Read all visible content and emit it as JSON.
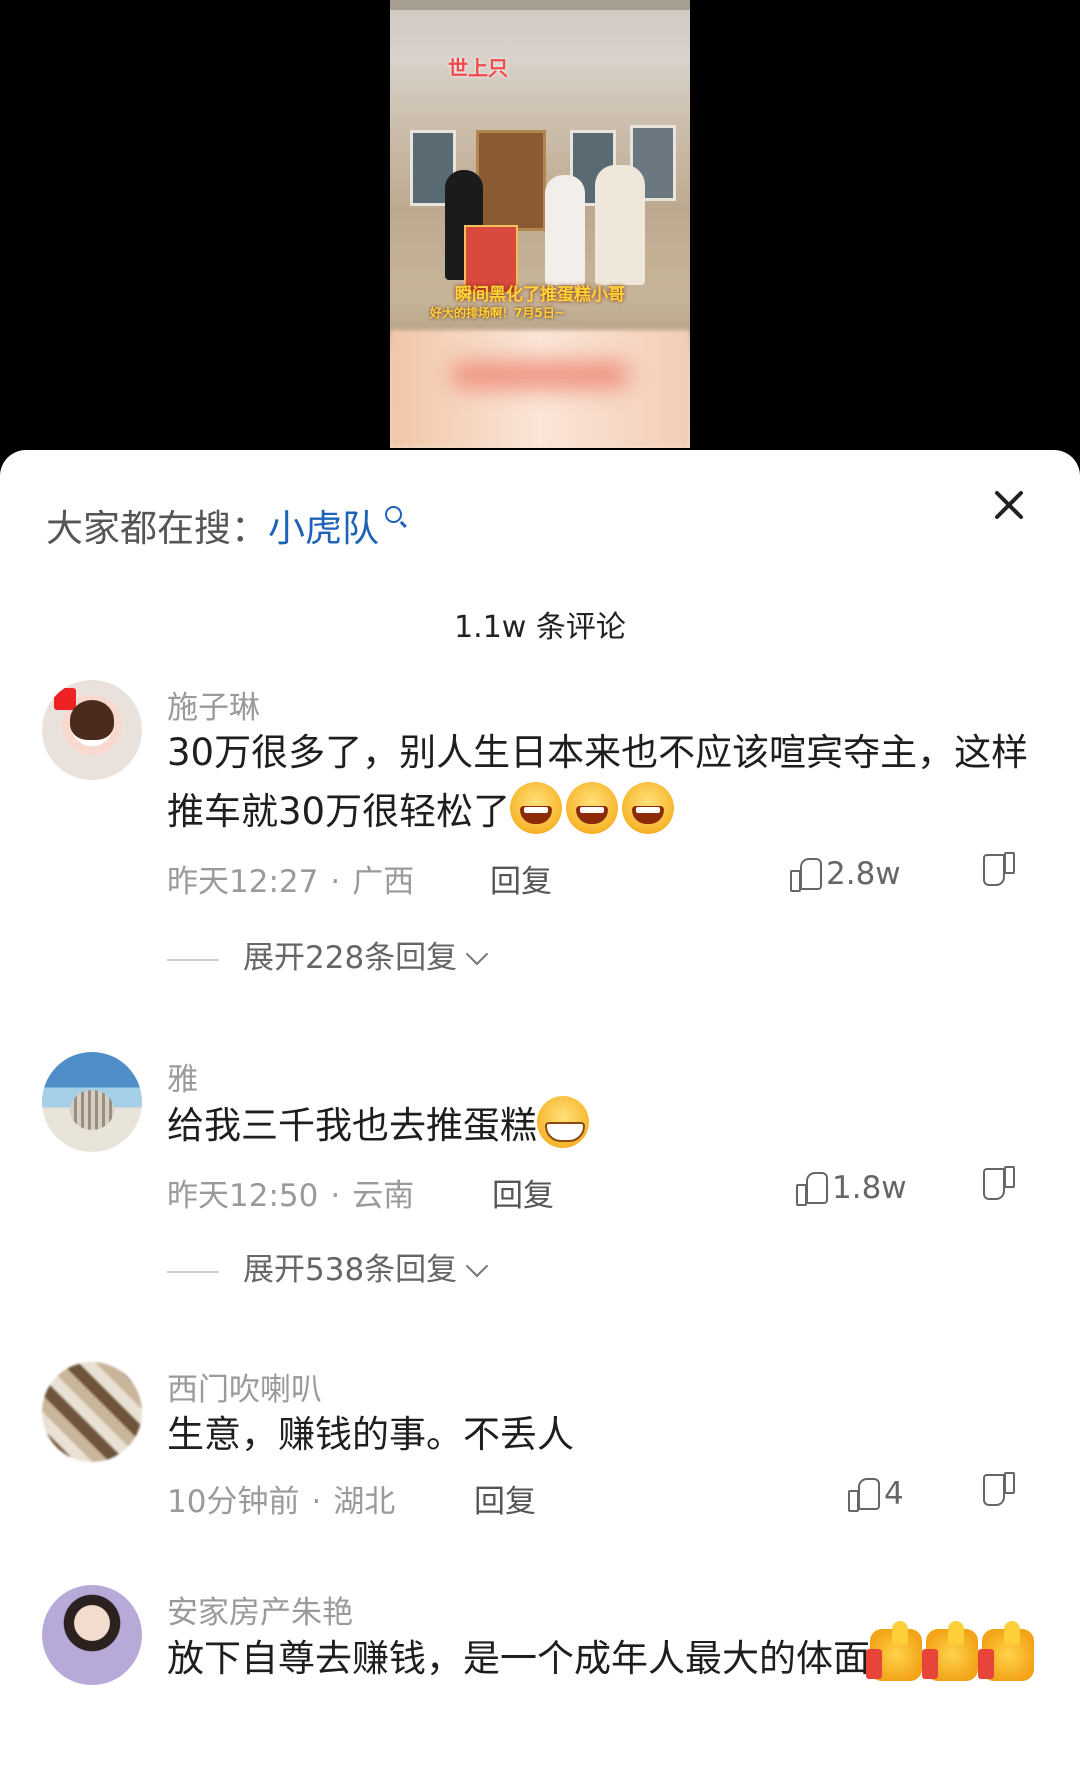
{
  "video": {
    "sign_text": "世上只",
    "caption_main": "瞬间黑化了推蛋糕小哥",
    "caption_sub": "好大的排场啊！7月5日~"
  },
  "sheet": {
    "search_prefix": "大家都在搜：",
    "search_keyword": "小虎队",
    "comment_count": "1.1w 条评论"
  },
  "comments": [
    {
      "username": "施子琳",
      "text": "30万很多了，别人生日本来也不应该喧宾夺主，这样推车就30万很轻松了",
      "emojis": [
        "laugh",
        "laugh",
        "laugh"
      ],
      "time": "昨天12:27",
      "location": "广西",
      "reply": "回复",
      "likes": "2.8w",
      "expand": "展开228条回复"
    },
    {
      "username": "雅",
      "text": "给我三千我也去推蛋糕",
      "emojis": [
        "grin"
      ],
      "time": "昨天12:50",
      "location": "云南",
      "reply": "回复",
      "likes": "1.8w",
      "expand": "展开538条回复"
    },
    {
      "username": "西门吹喇叭",
      "text": "生意，赚钱的事。不丢人",
      "time": "10分钟前",
      "location": "湖北",
      "reply": "回复",
      "likes": "4"
    },
    {
      "username": "安家房产朱艳",
      "text": "放下自尊去赚钱，是一个成年人最大的体面",
      "emojis": [
        "thumbs-up",
        "thumbs-up",
        "thumbs-up"
      ]
    }
  ]
}
